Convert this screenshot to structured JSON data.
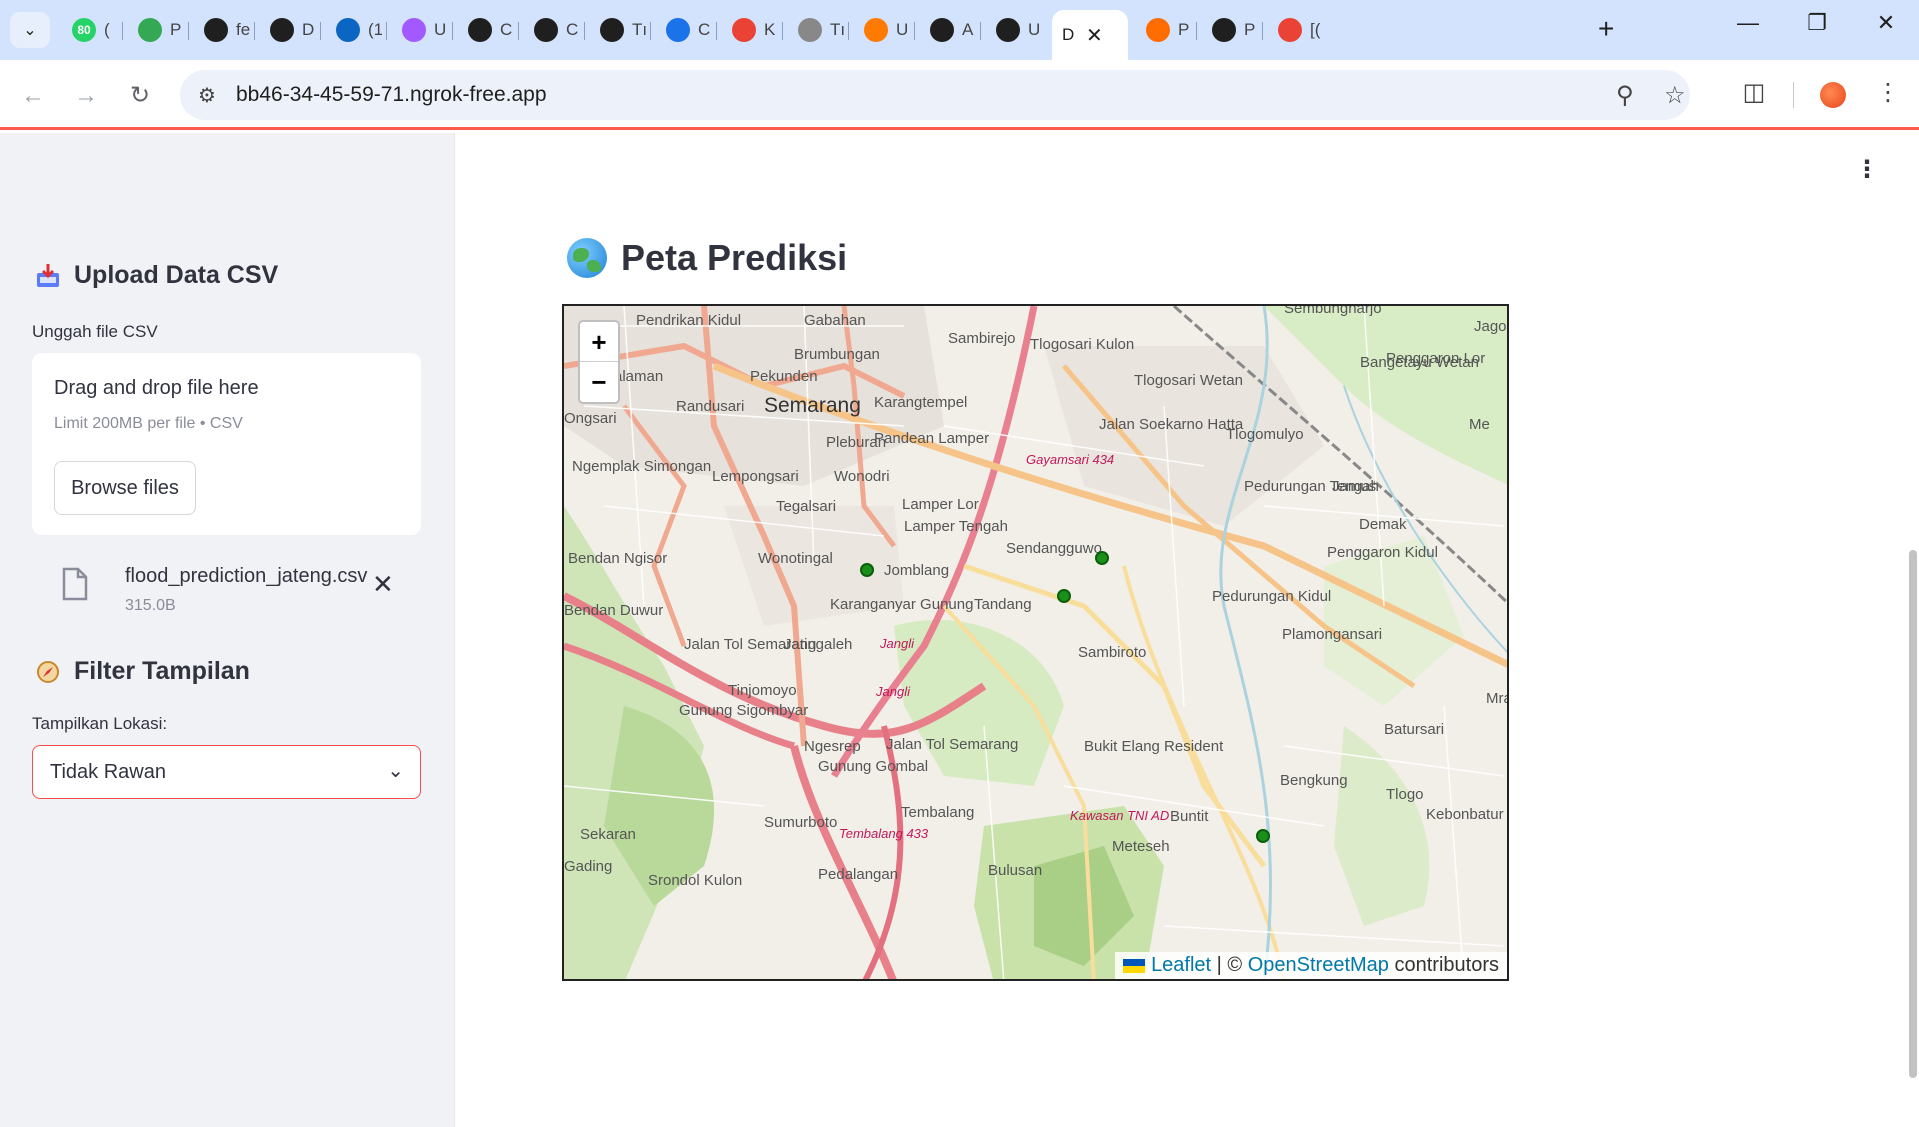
{
  "browser": {
    "tabs": [
      {
        "label": "(",
        "icon": "whatsapp-icon",
        "color": "#25d366",
        "badge": "80"
      },
      {
        "label": "P",
        "icon": "sheets-icon",
        "color": "#34a853"
      },
      {
        "label": "fe",
        "icon": "github-icon",
        "color": "#1f1f1f"
      },
      {
        "label": "D",
        "icon": "hexagon-icon",
        "color": "#1f1f1f"
      },
      {
        "label": "(1",
        "icon": "linkedin-icon",
        "color": "#0a66c2"
      },
      {
        "label": "U",
        "icon": "figma-icon",
        "color": "#a259ff"
      },
      {
        "label": "C",
        "icon": "leaf-icon",
        "color": "#1f1f1f"
      },
      {
        "label": "C",
        "icon": "leaf-icon",
        "color": "#1f1f1f"
      },
      {
        "label": "Tı",
        "icon": "leaf-icon",
        "color": "#1f1f1f"
      },
      {
        "label": "C",
        "icon": "shield-icon",
        "color": "#1a73e8"
      },
      {
        "label": "K",
        "icon": "gmail-icon",
        "color": "#ea4335"
      },
      {
        "label": "Tı",
        "icon": "globe-icon",
        "color": "#888888"
      },
      {
        "label": "U",
        "icon": "infinity-icon",
        "color": "#ff7a00"
      },
      {
        "label": "A",
        "icon": "github-icon",
        "color": "#1f1f1f"
      },
      {
        "label": "U",
        "icon": "github-icon",
        "color": "#1f1f1f"
      },
      {
        "label": "D",
        "icon": "none",
        "color": "#ffffff",
        "active": true
      },
      {
        "label": "P",
        "icon": "arc-icon",
        "color": "#ff6d00"
      },
      {
        "label": "P",
        "icon": "openai-icon",
        "color": "#1f1f1f"
      },
      {
        "label": "[(",
        "icon": "gmail-icon",
        "color": "#ea4335"
      }
    ],
    "url": "bb46-34-45-59-71.ngrok-free.app"
  },
  "sidebar": {
    "upload_heading": "Upload Data CSV",
    "upload_label": "Unggah file CSV",
    "dropzone_title": "Drag and drop file here",
    "dropzone_sub": "Limit 200MB per file • CSV",
    "browse_label": "Browse files",
    "file_name": "flood_prediction_jateng.csv",
    "file_size": "315.0B",
    "filter_heading": "Filter Tampilan",
    "filter_label": "Tampilkan Lokasi:",
    "filter_value": "Tidak Rawan"
  },
  "main": {
    "title": "Peta Prediksi",
    "zoom_in": "+",
    "zoom_out": "−",
    "attribution_leaflet": "Leaflet",
    "attribution_sep": " | © ",
    "attribution_osm": "OpenStreetMap",
    "attribution_tail": " contributors"
  },
  "map_labels": [
    "Pendrikan Kidul",
    "Gabahan",
    "Sambirejo",
    "Tlogosari Kulon",
    "Sembungharjo",
    "Jago",
    "Brumbungan",
    "Bangetayu Wetan",
    "Penggaron Lor",
    "Salaman",
    "Pekunden",
    "Randusari",
    "Semarang",
    "Karangtempel",
    "Tlogosari Wetan",
    "Ongsari",
    "Pleburan",
    "Pandean Lamper",
    "Tlogomulyo",
    "Me",
    "Ngemplak Simongan",
    "Lempongsari",
    "Wonodri",
    "Gayamsari 434",
    "Jalan Soekarno Hatta",
    "Tegalsari",
    "Lamper Lor",
    "Pedurungan Tengah",
    "Jamus",
    "Lamper Tengah",
    "Demak",
    "Bendan Ngisor",
    "Wonotingal",
    "Sendangguwo",
    "Penggaron Kidul",
    "Jomblang",
    "Pedurungan Kidul",
    "Tandang",
    "Bendan Duwur",
    "Karanganyar Gunung",
    "Plamongansari",
    "Jalan Tol Semarang",
    "Jatingaleh",
    "Jangli",
    "Sambiroto",
    "Mra",
    "Tinjomoyo",
    "Jangli",
    "Gunung Sigombyar",
    "Batursari",
    "Ngesrep",
    "Gunung Gombal",
    "Jalan Tol Semarang",
    "Bukit Elang Resident",
    "Bengkung",
    "Tlogo",
    "Tembalang",
    "Kawasan TNI AD",
    "Buntit",
    "Kebonbatur",
    "Sumurboto",
    "Tembalang 433",
    "Sekaran",
    "Meteseh",
    "Gading",
    "Srondol Kulon",
    "Pedalangan",
    "Bulusan"
  ],
  "markers": [
    {
      "name": "Wonotingal",
      "status": "Tidak Rawan"
    },
    {
      "name": "Sendangguwo",
      "status": "Tidak Rawan"
    },
    {
      "name": "Tandang",
      "status": "Tidak Rawan"
    },
    {
      "name": "Bengkung",
      "status": "Tidak Rawan"
    }
  ],
  "colors": {
    "accent": "#ff4b4b",
    "marker": "#1a8f1a",
    "sidebar_bg": "#f0f2f6",
    "tabstrip_bg": "#d3e3fd"
  }
}
